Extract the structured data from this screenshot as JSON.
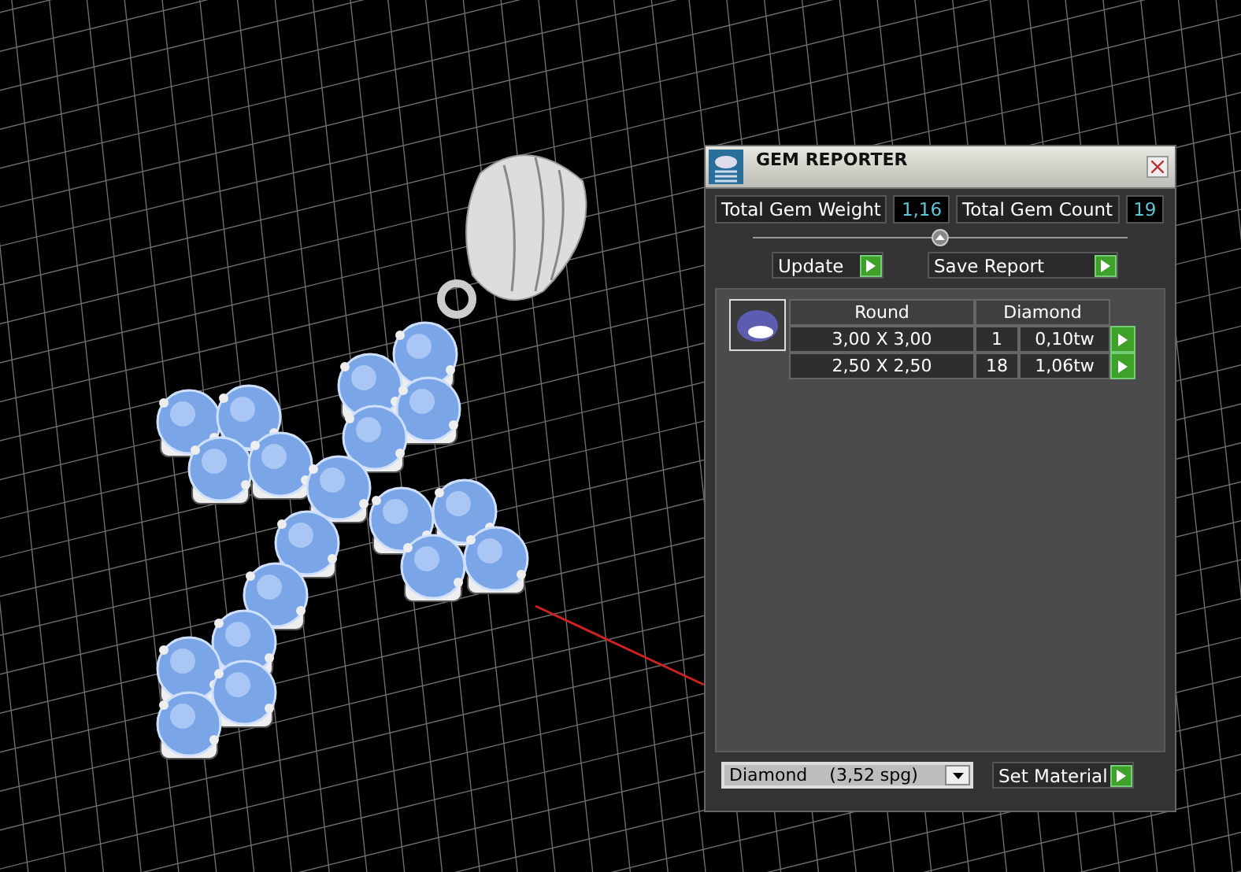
{
  "window": {
    "title": "GEM REPORTER"
  },
  "totals": [
    {
      "label": "Total Gem Weight",
      "value": "1,16"
    },
    {
      "label": "Total Gem Count",
      "value": "19"
    }
  ],
  "buttons": [
    "Update",
    "Save Report"
  ],
  "gem_table": {
    "columns": [
      "Round",
      "Diamond"
    ],
    "rows": [
      {
        "size": "3,00 X 3,00",
        "count": "1",
        "weight": "0,10tw"
      },
      {
        "size": "2,50 X 2,50",
        "count": "18",
        "weight": "1,06tw"
      }
    ]
  },
  "material": {
    "value": "Diamond    (3,52 spg)",
    "button": "Set Material"
  }
}
